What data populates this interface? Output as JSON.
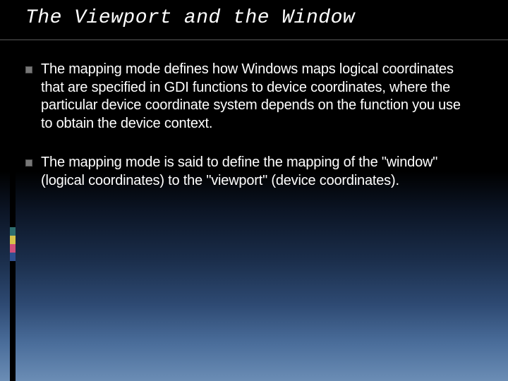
{
  "title": "The Viewport and the Window",
  "bullets": [
    "The mapping mode defines how Windows maps logical coordinates that are specified in GDI functions to device coordinates, where the particular device coordinate system depends on the function you use to obtain the device context.",
    "The mapping mode is said to define the mapping of the \"window\" (logical coordinates) to the \"viewport\" (device coordinates)."
  ],
  "accent_colors": [
    "#2f6e6e",
    "#d6c24a",
    "#cf4e7a",
    "#2f4f8f"
  ]
}
